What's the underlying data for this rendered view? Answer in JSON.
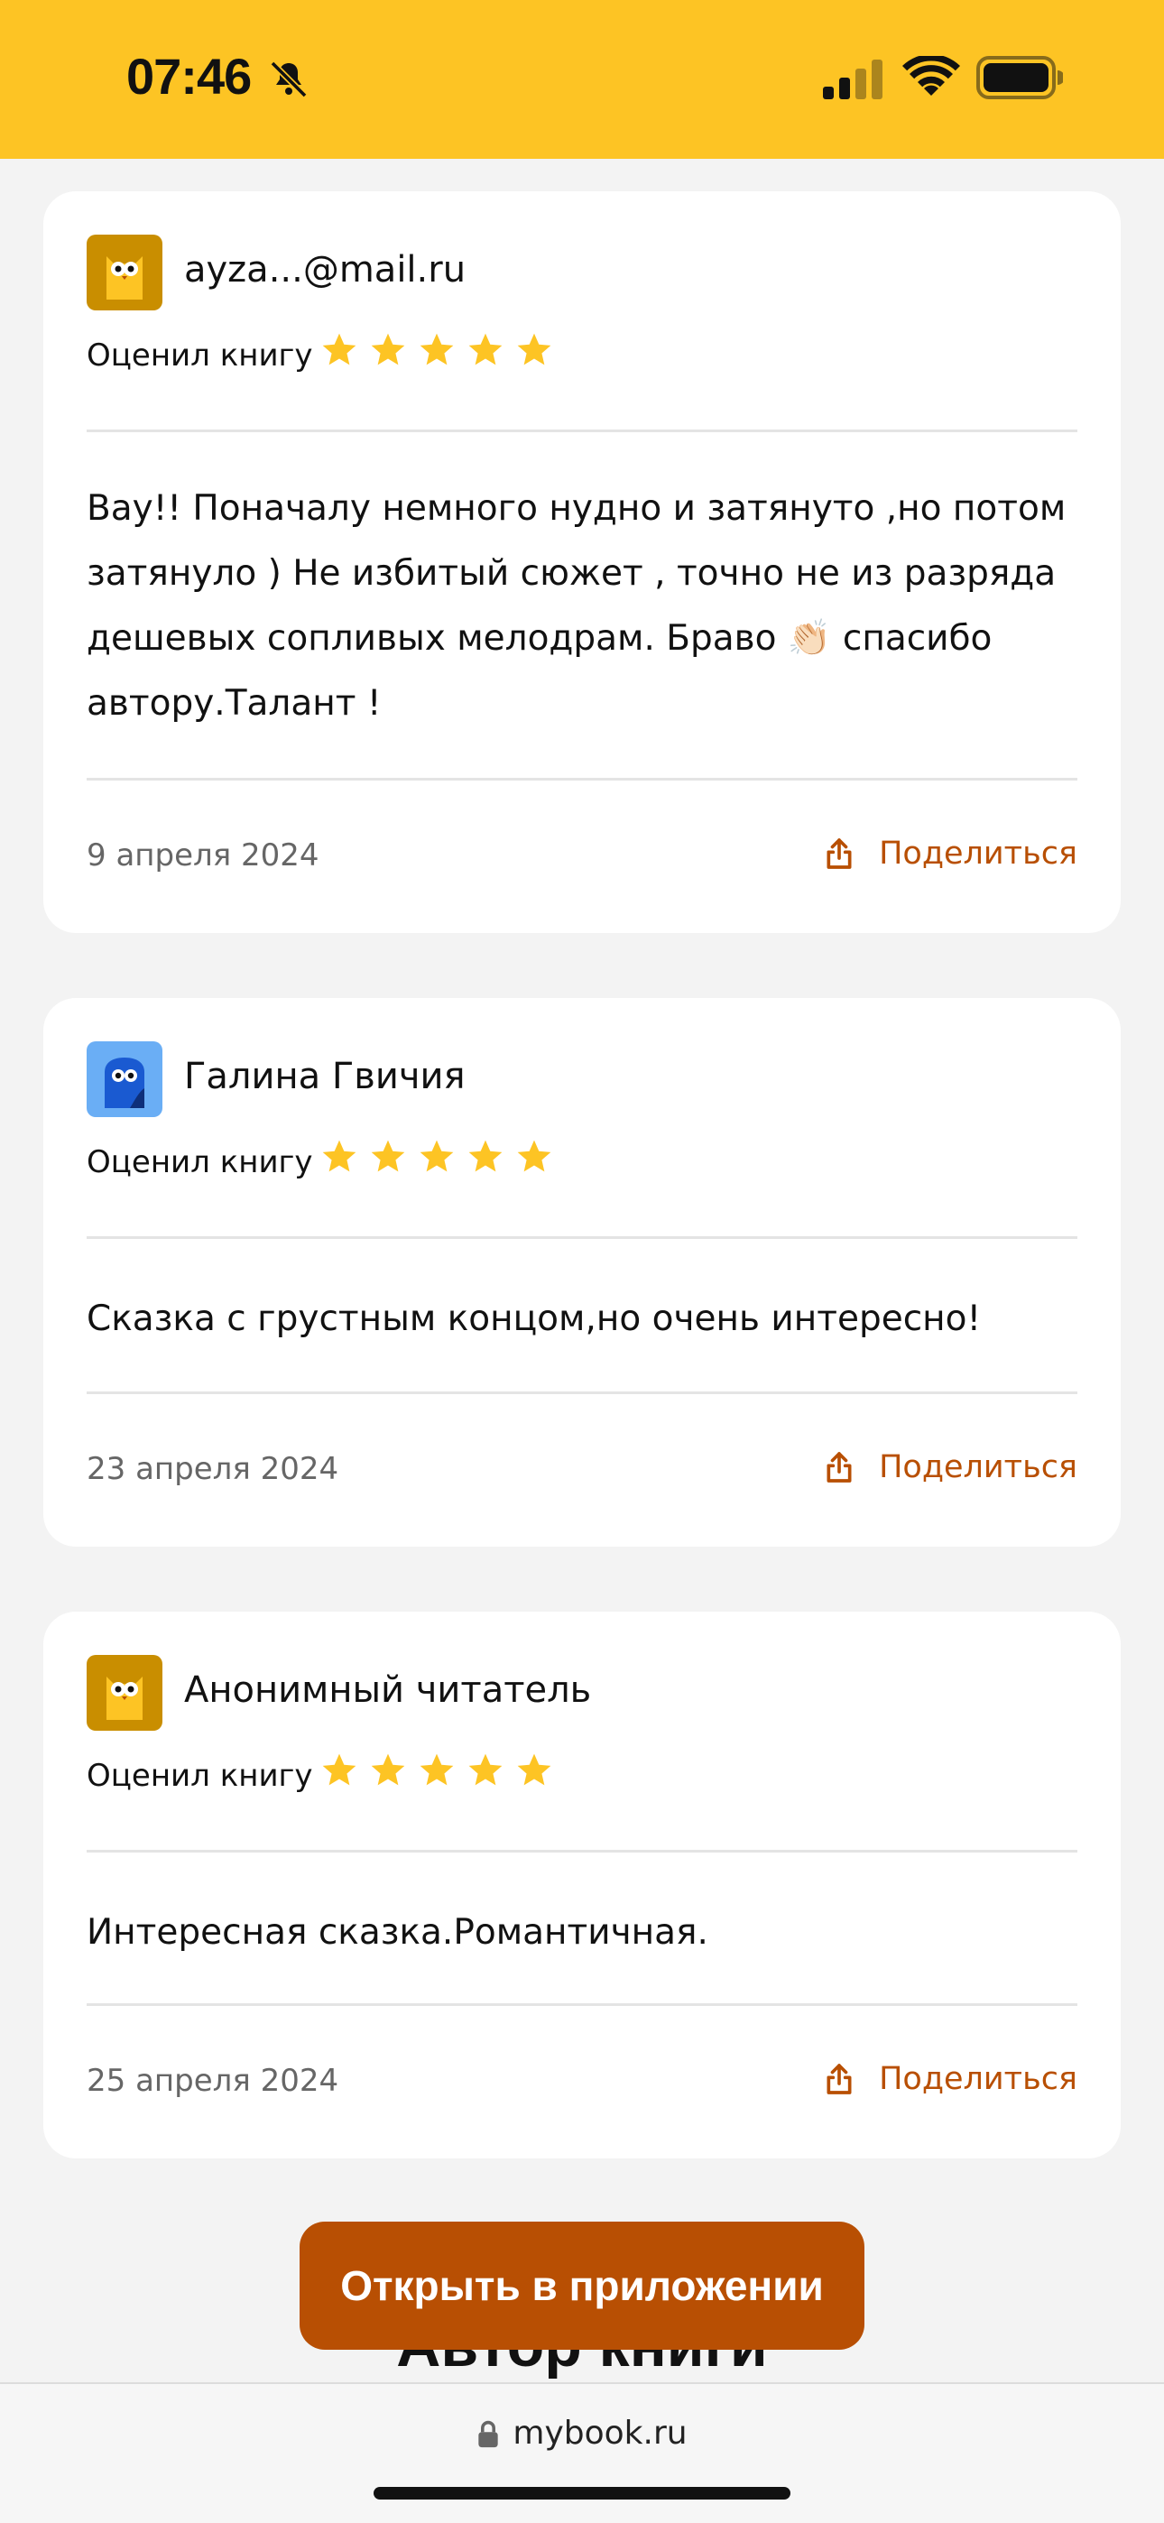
{
  "status_bar": {
    "time": "07:46",
    "bell_icon": "bell-slash-icon",
    "signal_icon": "cellular-signal-icon",
    "wifi_icon": "wifi-icon",
    "battery_icon": "battery-full-icon",
    "background_color": "#fdc424"
  },
  "reviews": [
    {
      "user": "ayza...@mail.ru",
      "avatar": "owl-yellow-icon",
      "rated_label": "Оценил книгу",
      "rating": 5,
      "text": "Вау!! Поначалу немного нудно и затянуто ,но потом затянуло ) Не избитый сюжет , точно не из разряда дешевых сопливых мелодрам. Браво 👏🏻 спасибо автору.Талант !",
      "date": "9 апреля 2024",
      "share_label": "Поделиться"
    },
    {
      "user": "Галина Гвичия",
      "avatar": "owl-blue-icon",
      "rated_label": "Оценил книгу",
      "rating": 5,
      "text": "Сказка с грустным концом,но очень интересно!",
      "date": "23 апреля 2024",
      "share_label": "Поделиться"
    },
    {
      "user": "Анонимный читатель",
      "avatar": "owl-yellow-icon",
      "rated_label": "Оценил книгу",
      "rating": 5,
      "text": "Интересная сказка.Романтичная.",
      "date": "25 апреля 2024",
      "share_label": "Поделиться"
    }
  ],
  "section_heading": "Автор книги",
  "open_app_button": "Открыть в приложении",
  "browser": {
    "url": "mybook.ru",
    "lock_icon": "lock-icon"
  },
  "colors": {
    "accent": "#b84f03",
    "star": "#fdc424",
    "background": "#f3f3f3"
  }
}
